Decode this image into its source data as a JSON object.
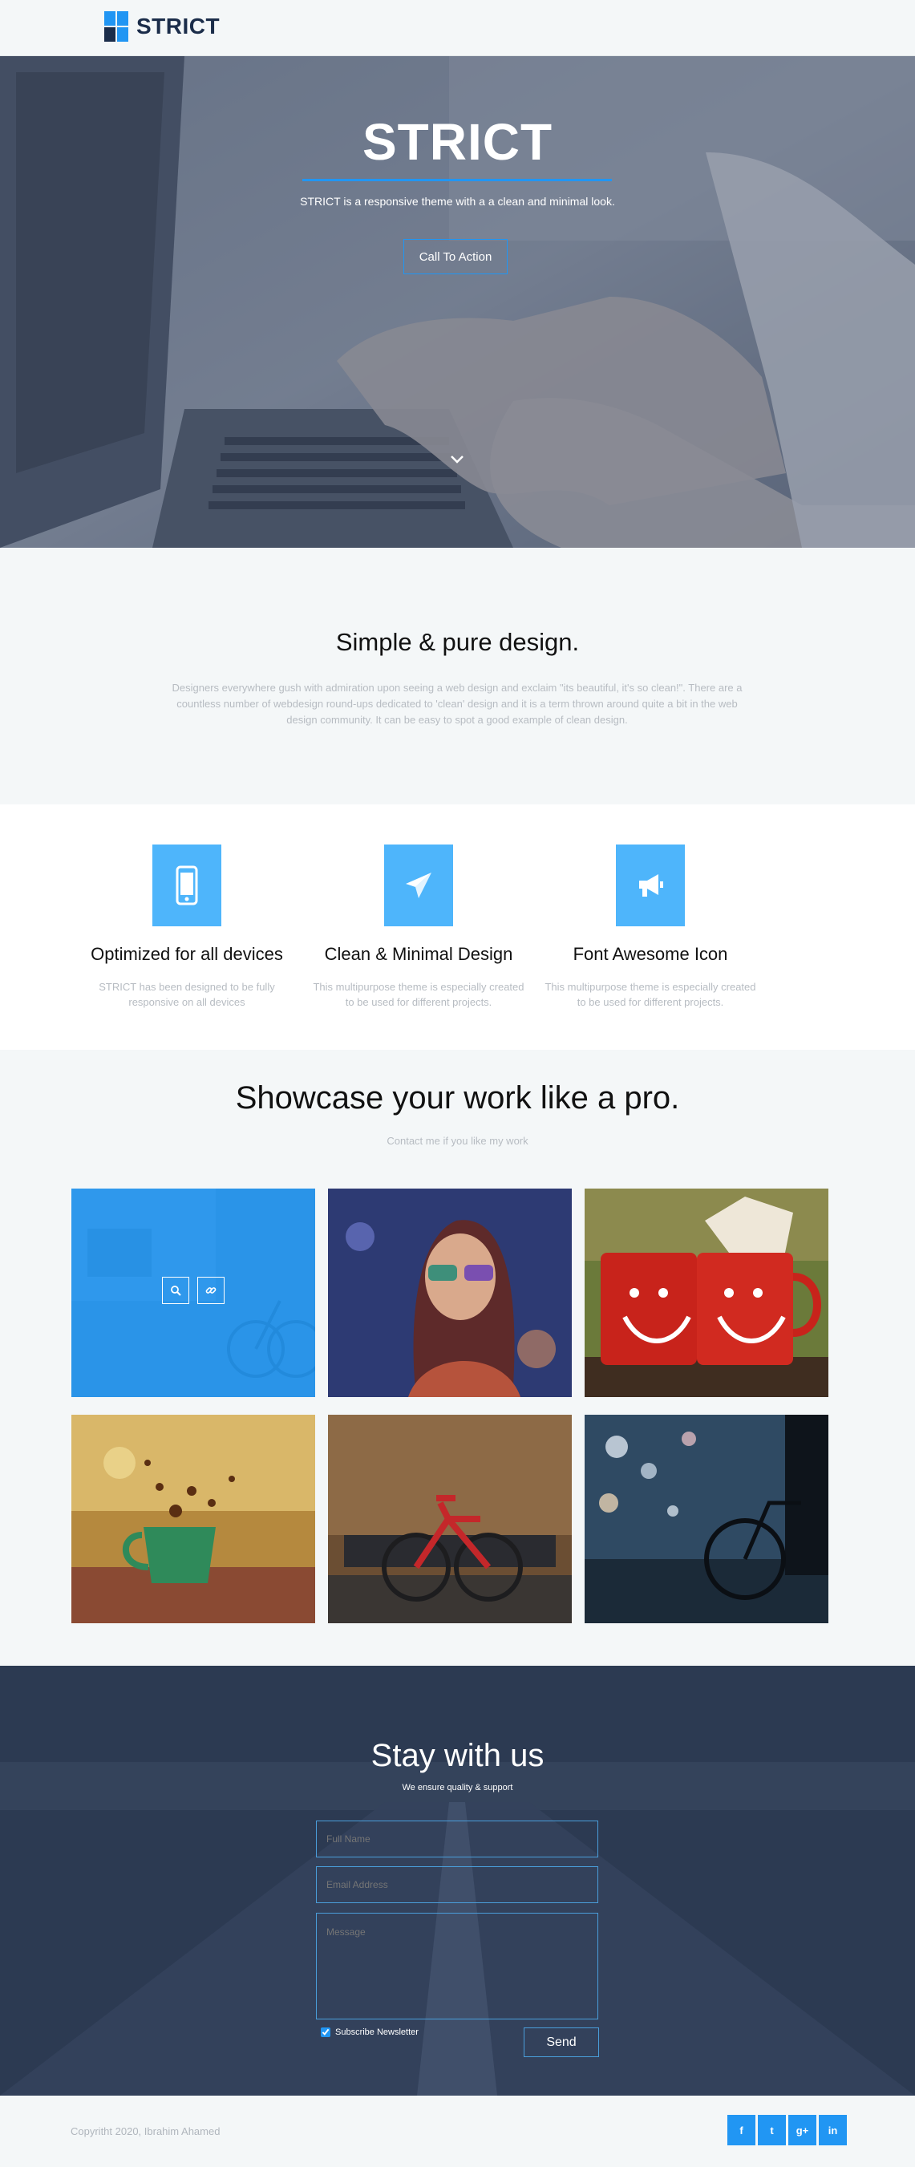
{
  "brand": {
    "name": "STRICT"
  },
  "hero": {
    "title": "STRICT",
    "subtitle": "STRICT is a responsive theme with a a clean and minimal look.",
    "cta_label": "Call To Action"
  },
  "intro": {
    "heading": "Simple & pure design.",
    "body": "Designers everywhere gush with admiration upon seeing a web design and exclaim \"its beautiful, it's so clean!\". There are a countless number of webdesign round-ups dedicated to 'clean' design and it is a term thrown around quite a bit in the web design community. It can be easy to spot a good example of clean design."
  },
  "features": [
    {
      "icon": "mobile-icon",
      "title": "Optimized for all devices",
      "text": "STRICT has been designed to be fully responsive on all devices"
    },
    {
      "icon": "paper-plane-icon",
      "title": "Clean & Minimal Design",
      "text": "This multipurpose theme is especially created to be used for different projects."
    },
    {
      "icon": "bullhorn-icon",
      "title": "Font Awesome Icon",
      "text": "This multipurpose theme is especially created to be used for different projects."
    }
  ],
  "showcase": {
    "heading": "Showcase your work like a pro.",
    "subheading": "Contact me if you like my work",
    "items": [
      {
        "name": "bicycle-street",
        "hovered": true,
        "icons": [
          "zoom-icon",
          "link-icon"
        ]
      },
      {
        "name": "woman-sunglasses"
      },
      {
        "name": "red-smiley-mugs"
      },
      {
        "name": "coffee-splash-cup"
      },
      {
        "name": "red-bicycle-bench"
      },
      {
        "name": "bicycle-bokeh-night"
      }
    ]
  },
  "contact": {
    "heading": "Stay with us",
    "subheading": "We ensure quality & support",
    "name_placeholder": "Full Name",
    "email_placeholder": "Email Address",
    "message_placeholder": "Message",
    "subscribe_label": "Subscribe Newsletter",
    "subscribe_checked": true,
    "send_label": "Send"
  },
  "footer": {
    "copyright": "Copyritht 2020, Ibrahim Ahamed",
    "socials": [
      {
        "icon": "facebook-icon",
        "glyph": "f"
      },
      {
        "icon": "twitter-icon",
        "glyph": "t"
      },
      {
        "icon": "google-plus-icon",
        "glyph": "g+"
      },
      {
        "icon": "linkedin-icon",
        "glyph": "in"
      }
    ]
  },
  "colors": {
    "accent": "#2196f3",
    "dark": "#2c3a52",
    "muted": "#b7bcc2"
  }
}
